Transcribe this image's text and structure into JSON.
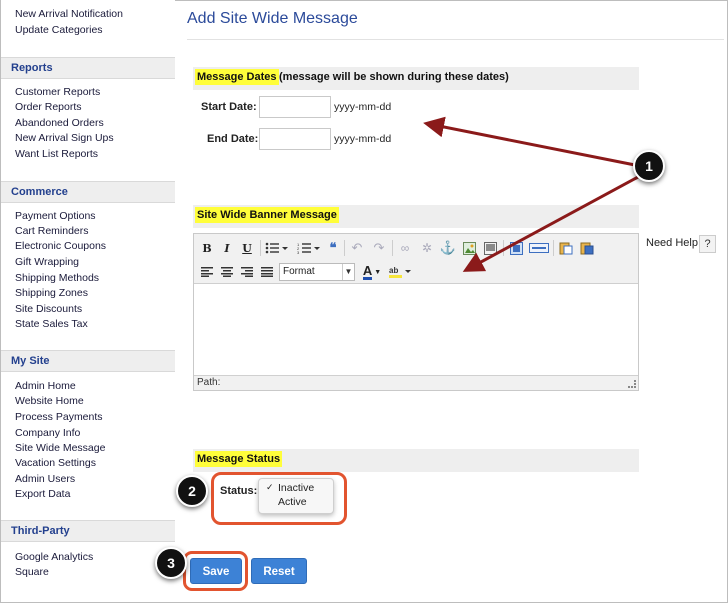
{
  "sidebar": {
    "top_links": [
      "New Arrival Notification",
      "Update Categories"
    ],
    "sections": [
      {
        "heading": "Reports",
        "links": [
          "Customer Reports",
          "Order Reports",
          "Abandoned Orders",
          "New Arrival Sign Ups",
          "Want List Reports"
        ]
      },
      {
        "heading": "Commerce",
        "links": [
          "Payment Options",
          "Cart Reminders",
          "Electronic Coupons",
          "Gift Wrapping",
          "Shipping Methods",
          "Shipping Zones",
          "Site Discounts",
          "State Sales Tax"
        ]
      },
      {
        "heading": "My Site",
        "links": [
          "Admin Home",
          "Website Home",
          "Process Payments",
          "Company Info",
          "Site Wide Message",
          "Vacation Settings",
          "Admin Users",
          "Export Data"
        ]
      },
      {
        "heading": "Third-Party",
        "links": [
          "Google Analytics",
          "Square"
        ]
      }
    ]
  },
  "main": {
    "title": "Add Site Wide Message",
    "message_dates": {
      "heading": "Message Dates",
      "heading_note": "(message will be shown during these dates)",
      "start_label": "Start Date:",
      "start_value": "",
      "start_hint": "yyyy-mm-dd",
      "end_label": "End Date:",
      "end_value": "",
      "end_hint": "yyyy-mm-dd"
    },
    "banner": {
      "heading": "Site Wide Banner Message",
      "toolbar": {
        "bold": "B",
        "italic": "I",
        "underline": "U",
        "format_select": "Format",
        "text_color": "A"
      },
      "path_label": "Path:",
      "need_help": "Need Help",
      "help_button": "?"
    },
    "message_status": {
      "heading": "Message Status",
      "status_label": "Status:",
      "options": [
        "Inactive",
        "Active"
      ],
      "selected": "Inactive",
      "checkmark": "✓"
    },
    "buttons": {
      "save": "Save",
      "reset": "Reset"
    }
  },
  "callouts": [
    "1",
    "2",
    "3"
  ],
  "colors": {
    "accent": "#3d82d6",
    "highlight": "#fffe3a",
    "callout_ring": "#e2542f",
    "arrow": "#8b1a1a",
    "title": "#2b4a9a"
  }
}
